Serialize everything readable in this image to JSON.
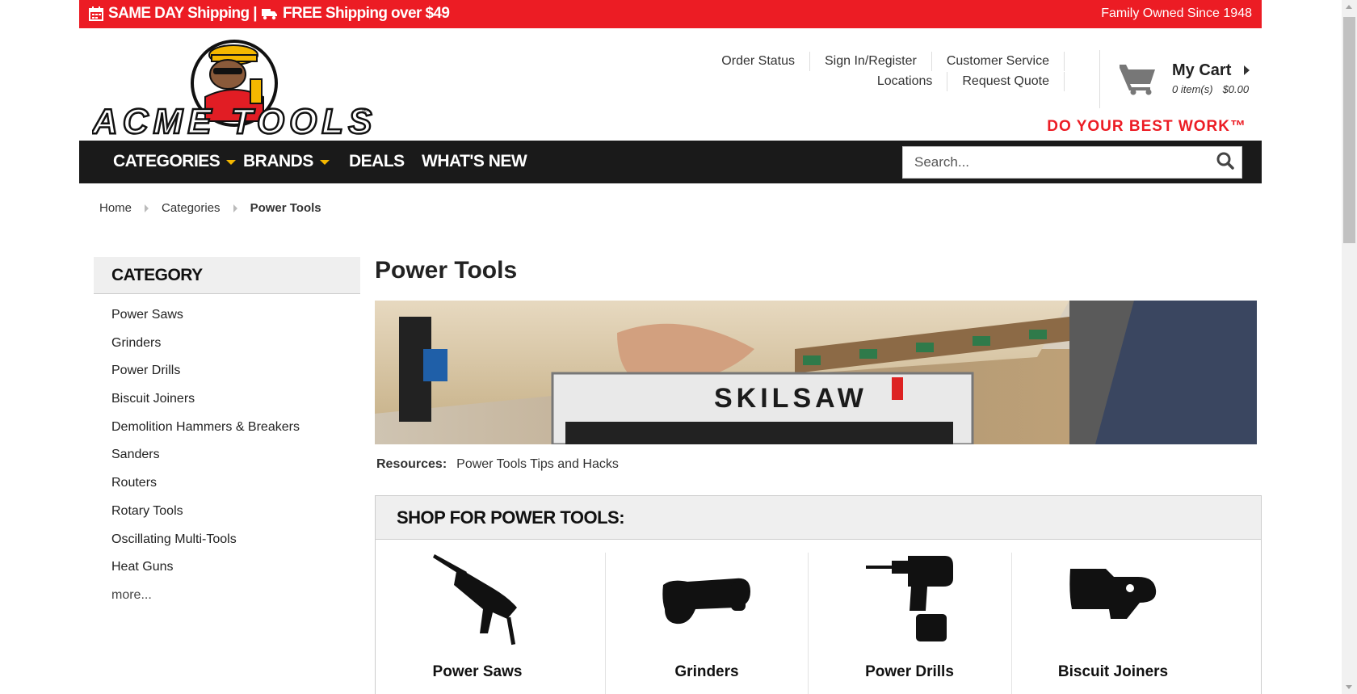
{
  "topbar": {
    "shipping_text": "SAME DAY Shipping | ",
    "free_text": "FREE Shipping over $49",
    "family": "Family Owned Since 1948",
    "bg_color": "#ec1c24"
  },
  "logo": {
    "text": "ACME TOOLS"
  },
  "utility_links": {
    "row1": [
      "Order Status",
      "Sign In/Register",
      "Customer Service"
    ],
    "row2": [
      "Locations",
      "Request Quote"
    ]
  },
  "cart": {
    "title": "My Cart",
    "items": "0 item(s)",
    "total": "$0.00"
  },
  "tagline": "DO YOUR BEST WORK™",
  "nav": {
    "items": [
      "CATEGORIES",
      "BRANDS",
      "DEALS",
      "WHAT'S NEW"
    ],
    "accent": "#f5b800"
  },
  "search": {
    "placeholder": "Search..."
  },
  "breadcrumb": [
    "Home",
    "Categories",
    "Power Tools"
  ],
  "sidebar": {
    "heading": "CATEGORY",
    "items": [
      "Power Saws",
      "Grinders",
      "Power Drills",
      "Biscuit Joiners",
      "Demolition Hammers & Breakers",
      "Sanders",
      "Routers",
      "Rotary Tools",
      "Oscillating Multi-Tools",
      "Heat Guns"
    ],
    "more": "more..."
  },
  "main": {
    "title": "Power Tools",
    "hero_brand": "SKILSAW",
    "resources_label": "Resources:",
    "resources_link": "Power Tools Tips and Hacks",
    "shop_heading": "SHOP FOR POWER TOOLS:",
    "tiles": [
      "Power Saws",
      "Grinders",
      "Power Drills",
      "Biscuit Joiners"
    ]
  }
}
